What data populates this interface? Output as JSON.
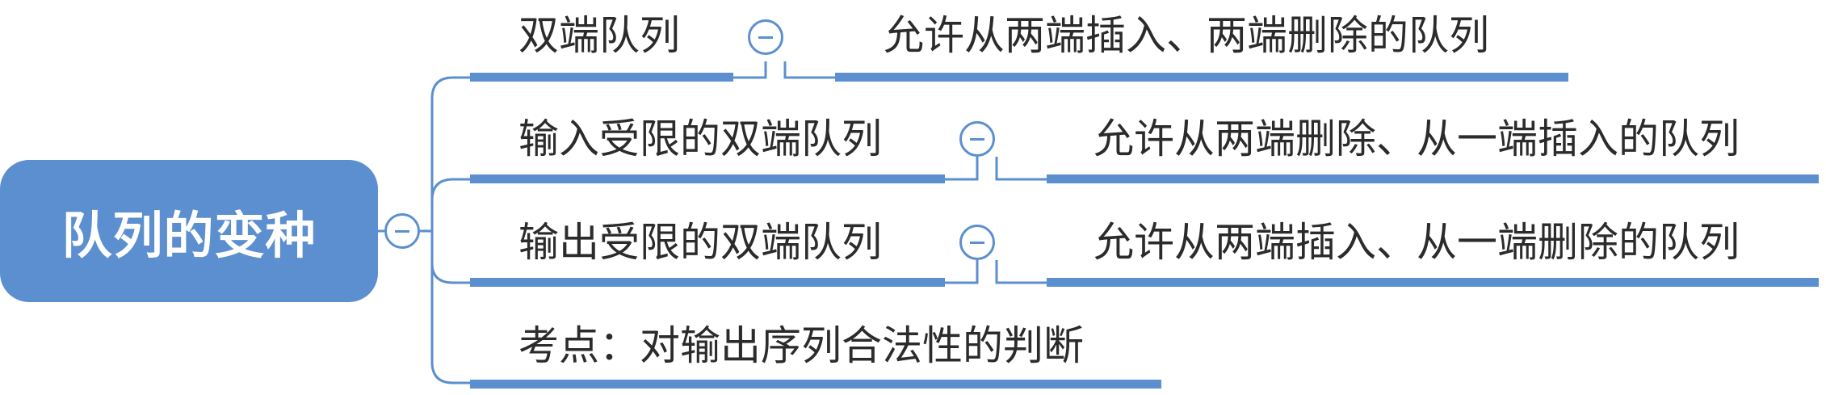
{
  "root": {
    "label": "队列的变种"
  },
  "branches": [
    {
      "label": "双端队列",
      "description": "允许从两端插入、两端删除的队列"
    },
    {
      "label": "输入受限的双端队列",
      "description": "允许从两端删除、从一端插入的队列"
    },
    {
      "label": "输出受限的双端队列",
      "description": "允许从两端插入、从一端删除的队列"
    },
    {
      "label": "考点：对输出序列合法性的判断"
    }
  ],
  "colors": {
    "accent": "#5b8fcf",
    "text": "#2b2b2b"
  },
  "icons": [
    "collapse-icon"
  ]
}
